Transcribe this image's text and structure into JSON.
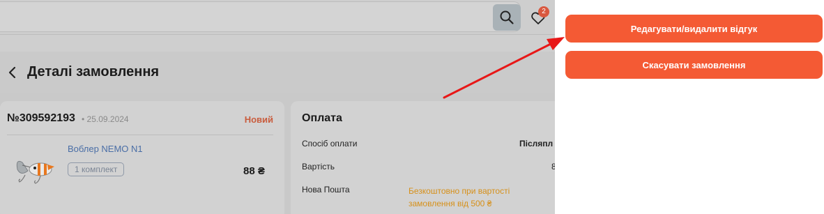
{
  "header": {
    "search_icon": "search-icon",
    "favorites_icon": "heart-icon",
    "favorites_count": "2"
  },
  "page": {
    "back_icon": "chevron-left-icon",
    "title": "Деталі замовлення"
  },
  "order": {
    "number": "№309592193",
    "date": "• 25.09.2024",
    "status": "Новий",
    "status_color": "#c95d3e",
    "product": {
      "name": "Воблер NEMO N1",
      "quantity": "1 комплект",
      "price": "88 ₴"
    }
  },
  "payment": {
    "title": "Оплата",
    "rows": [
      {
        "label": "Спосіб оплати",
        "value": "Післяпл"
      },
      {
        "label": "Вартість",
        "value": "8"
      },
      {
        "label": "Нова Пошта",
        "value": "Безкоштовно при вартості замовлення від 500 ₴"
      }
    ]
  },
  "actions": {
    "edit_review": "Редагувати/видалити відгук",
    "cancel_order": "Скасувати замовлення",
    "accent_color": "#f45a34"
  },
  "annotation": {
    "arrow_color": "#e81717"
  }
}
